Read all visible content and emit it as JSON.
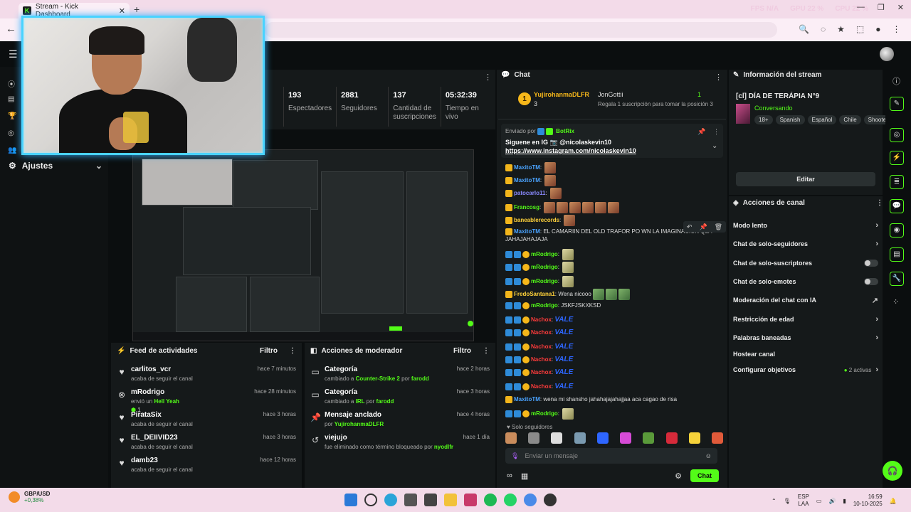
{
  "browser": {
    "tab_title": "Stream - Kick Dashboard",
    "perf": [
      "FPS N/A",
      "GPU 22 %",
      "CPU 22 %"
    ]
  },
  "left_nav": {
    "settings_label": "Ajustes"
  },
  "stats": [
    {
      "value": "193",
      "label": "Espectadores"
    },
    {
      "value": "2881",
      "label": "Seguidores"
    },
    {
      "value": "137",
      "label": "Cantidad de suscripciones"
    },
    {
      "value": "05:32:39",
      "label": "Tiempo en vivo"
    }
  ],
  "feed": {
    "title": "Feed de actividades",
    "filter": "Filtro",
    "items": [
      {
        "name": "carlitos_vcr",
        "sub": "acaba de seguir el canal",
        "time": "hace 7 minutos"
      },
      {
        "name": "mRodrigo",
        "sub_pre": "envió un",
        "sub_hl": "Hell Yeah",
        "count": "1",
        "time": "hace 28 minutos"
      },
      {
        "name": "PirataSix",
        "sub": "acaba de seguir el canal",
        "time": "hace 3 horas"
      },
      {
        "name": "EL_DEIIVID23",
        "sub": "acaba de seguir el canal",
        "time": "hace 3 horas"
      },
      {
        "name": "damb23",
        "sub": "acaba de seguir el canal",
        "time": "hace 12 horas"
      }
    ]
  },
  "mod": {
    "title": "Acciones de moderador",
    "filter": "Filtro",
    "items": [
      {
        "name": "Categoría",
        "sub_pre": "cambiado a",
        "hl1": "Counter-Strike 2",
        "mid": "por",
        "hl2": "farodd",
        "time": "hace 2 horas"
      },
      {
        "name": "Categoría",
        "sub_pre": "cambiado a",
        "hl1": "IRL",
        "mid": "por",
        "hl2": "farodd",
        "time": "hace 3 horas"
      },
      {
        "name": "Mensaje anclado",
        "sub_pre": "por",
        "hl1": "YujirohanmaDLFR",
        "time": "hace 4 horas"
      },
      {
        "name": "viejujo",
        "sub_pre": "fue eliminado como término bloqueado por",
        "hl1": "nyodlfr",
        "time": "hace 1 día"
      }
    ]
  },
  "chat": {
    "title": "Chat",
    "top_gifter": {
      "name": "YujirohanmaDLFR",
      "count": "3",
      "second": "JonGottii",
      "second_count": "1",
      "note": "Regala 1 suscripción para tomar la posición 3"
    },
    "pinned": {
      "by_label": "Enviado por",
      "by": "BotRix",
      "line1": "Siguene en IG 📷 @nicolaskevin10",
      "link": "https://www.instagram.com/nicolaskevin10"
    },
    "messages": [
      {
        "user": "MaxitoTM",
        "color": "#4aa3ff",
        "text": "",
        "emotes": 1
      },
      {
        "user": "MaxitoTM",
        "color": "#4aa3ff",
        "text": "",
        "emotes": 1
      },
      {
        "user": "patocarlo11",
        "color": "#8a8aff",
        "text": "",
        "emotes": 1
      },
      {
        "user": "Francosg",
        "color": "#53fc18",
        "text": "",
        "emotes": 6
      },
      {
        "user": "baneablerecords",
        "color": "#ffd23a",
        "text": "",
        "emotes": 1
      },
      {
        "user": "MaxitoTM",
        "color": "#4aa3ff",
        "text": "EL CAMARIIN DEL OLD TRAFOR PO WN LA IMAGINACION QLA JAHAJAHAJAJA",
        "emotes": 0
      },
      {
        "user": "mRodrigo",
        "color": "#53fc18",
        "text": "",
        "emotes": 1
      },
      {
        "user": "mRodrigo",
        "color": "#53fc18",
        "text": "",
        "emotes": 1
      },
      {
        "user": "mRodrigo",
        "color": "#53fc18",
        "text": "",
        "emotes": 1
      },
      {
        "user": "FredoSantana1",
        "color": "#ffd23a",
        "text": "Wena nicooo",
        "emotes": 3
      },
      {
        "user": "mRodrigo",
        "color": "#53fc18",
        "text": "JSKFJSKXKSD",
        "emotes": 0
      },
      {
        "user": "Nachox",
        "color": "#ff3b3b",
        "text": "VALE",
        "emotes": 0
      },
      {
        "user": "Nachox",
        "color": "#ff3b3b",
        "text": "VALE",
        "emotes": 0
      },
      {
        "user": "Nachox",
        "color": "#ff3b3b",
        "text": "VALE",
        "emotes": 0
      },
      {
        "user": "Nachox",
        "color": "#ff3b3b",
        "text": "VALE",
        "emotes": 0
      },
      {
        "user": "Nachox",
        "color": "#ff3b3b",
        "text": "VALE",
        "emotes": 0
      },
      {
        "user": "Nachox",
        "color": "#ff3b3b",
        "text": "VALE",
        "emotes": 0
      },
      {
        "user": "MaxitoTM",
        "color": "#4aa3ff",
        "text": "wena mi shansho jahahajajahajjaa aca cagao de risa",
        "emotes": 0
      },
      {
        "user": "mRodrigo",
        "color": "#53fc18",
        "text": "",
        "emotes": 1
      }
    ],
    "followers_only": "Solo seguidores",
    "placeholder": "Enviar un mensaje",
    "send": "Chat"
  },
  "info": {
    "title": "Información del stream",
    "stream_title": "[cl] DÍA DE TERÁPIA N°9",
    "category": "Conversando",
    "tags": [
      "18+",
      "Spanish",
      "Español",
      "Chile",
      "Shoote"
    ],
    "edit": "Editar"
  },
  "channel": {
    "title": "Acciones de canal",
    "rows": [
      "Modo lento",
      "Chat de solo-seguidores",
      "Chat de solo-suscriptores",
      "Chat de solo-emotes",
      "Moderación del chat con IA",
      "Restricción de edad",
      "Palabras baneadas",
      "Hostear canal",
      "Configurar objetivos"
    ],
    "goals_active": "2 activas"
  },
  "taskbar": {
    "fx_pair": "GBP/USD",
    "fx_change": "+0,38%",
    "lang1": "ESP",
    "lang2": "LAA",
    "time": "16:59",
    "date": "10-10-2025"
  }
}
